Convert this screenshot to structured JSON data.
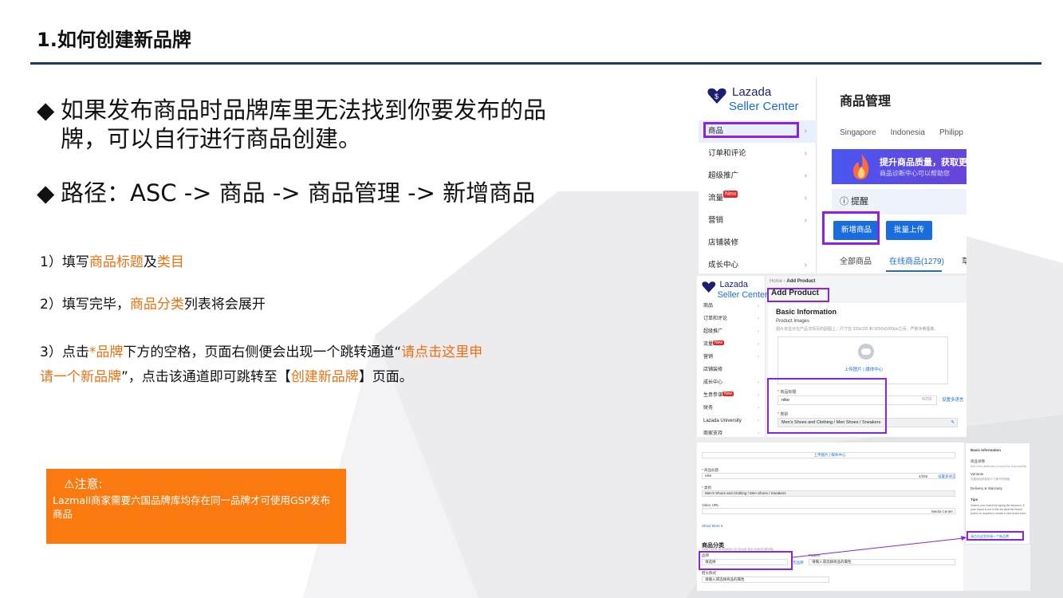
{
  "slide": {
    "title": "1.如何创建新品牌",
    "bullet_mark": "◆",
    "bullet1_line1": "如果发布商品时品牌库里无法找到你要发布的品",
    "bullet1_line2": "牌，可以自行进行商品创建。",
    "bullet2": "路径：ASC -> 商品 -> 商品管理 -> 新增商品",
    "step1": {
      "a": "1）填写",
      "b": "商品标题",
      "c": "及",
      "d": "类目"
    },
    "step2": {
      "a": "2）填写完毕，",
      "b": "商品分类",
      "c": "列表将会展开"
    },
    "step3": {
      "a": "3）点击",
      "b": "*品牌",
      "c": "下方的空格，页面右侧便会出现一个跳转通道“",
      "d": "请点击这里申请一个新品牌",
      "e": "”，点击该通道即可跳转至【",
      "f": "创建新品牌",
      "g": "】页面。"
    },
    "note": {
      "icon": "⚠",
      "title": "注意:",
      "body": "Lazmall商家需要六国品牌库均存在同一品牌才可使用GSP发布商品"
    },
    "colors": {
      "accent": "#f07010",
      "rule": "#1e3a5f",
      "highlight_box": "#8b22e6",
      "note_bg": "#fa7a10"
    }
  },
  "shot1": {
    "logo_line1": "Lazada",
    "logo_line2": "Seller Center",
    "menu": [
      "商品",
      "订单和评论",
      "超级推广",
      "流量",
      "营销",
      "店铺装修",
      "成长中心"
    ],
    "menu_new_badge": "New",
    "chevron": "›",
    "heading": "商品管理",
    "countries": [
      "Singapore",
      "Indonesia",
      "Philipp"
    ],
    "banner_title": "提升商品质量，获取更",
    "banner_sub": "商品诊断中心可以帮助您",
    "reminder": "ⓘ 提醒",
    "btn_add": "新增商品",
    "btn_batch": "批量上传",
    "tabs": [
      "全部商品",
      "在线商品(1279)",
      "草"
    ]
  },
  "shot2": {
    "logo_line1": "Lazada",
    "logo_line2": "Seller Center",
    "menu": [
      "商品",
      "订单和评论",
      "超级推广",
      "流量",
      "营销",
      "店铺装修",
      "成长中心",
      "生意参谋",
      "财务",
      "Lazada University",
      "商家支持"
    ],
    "new_badge": "New",
    "crumb_home": "Home",
    "crumb_sep": "›",
    "crumb_current": "Add Product",
    "title": "Add Product",
    "section": "Basic Information",
    "images_label": "Product Images",
    "images_hint": "图片将显示在产品详情页的副图上，尺寸在 330x330 和 5000x5000px之间，严禁涉黄图像。",
    "upload_text": "上传图片 | 媒体中心",
    "name_label": "商品标题",
    "name_value": "nike",
    "name_count": "4/255",
    "name_link": "设置多语言",
    "cat_label": "类别",
    "cat_value": "Men's Shoes and Clothing / Men Shoes / Sneakers",
    "star": "*",
    "edit_icon": "✎"
  },
  "shot3": {
    "upload_text": "上传图片 | 媒体中心",
    "name_label": "* 商品标题",
    "name_value": "nike",
    "name_count": "4/255",
    "name_link": "设置多语言",
    "cat_label": "* 类别",
    "cat_value": "Men's Shoes and Clothing / Men Shoes / Sneakers",
    "video_label": "Video URL",
    "media_center": "Media Center",
    "show_more": "Show More ▾",
    "cat_section": "商品分类",
    "cat_section_hint": "Add more attributes to boost the searchability",
    "brand_label": "品牌",
    "brand_placeholder": "请选择",
    "no_brand": "无品牌",
    "pattern_label": "Pattern",
    "pattern_placeholder": "请输入或选择商品的属性",
    "extra_label": "鞋尖款式",
    "extra_placeholder": "请输入或选择商品的属性",
    "panel_title": "Basic Information",
    "panel_items": [
      "商品详情",
      "Variants",
      "Delivery & Warranty"
    ],
    "panel_item1_hint": "Add more attributes to boost the searchability",
    "panel_item2_hint": "设置商品颜色和尺寸等不同规格",
    "tips_title": "Tips",
    "tips_body": "Search your brand by typing the keyword. If your brand is not in the list click the Brand button or request to create a new brand here.",
    "tips_link": "请点击这里申请一个新品牌"
  }
}
